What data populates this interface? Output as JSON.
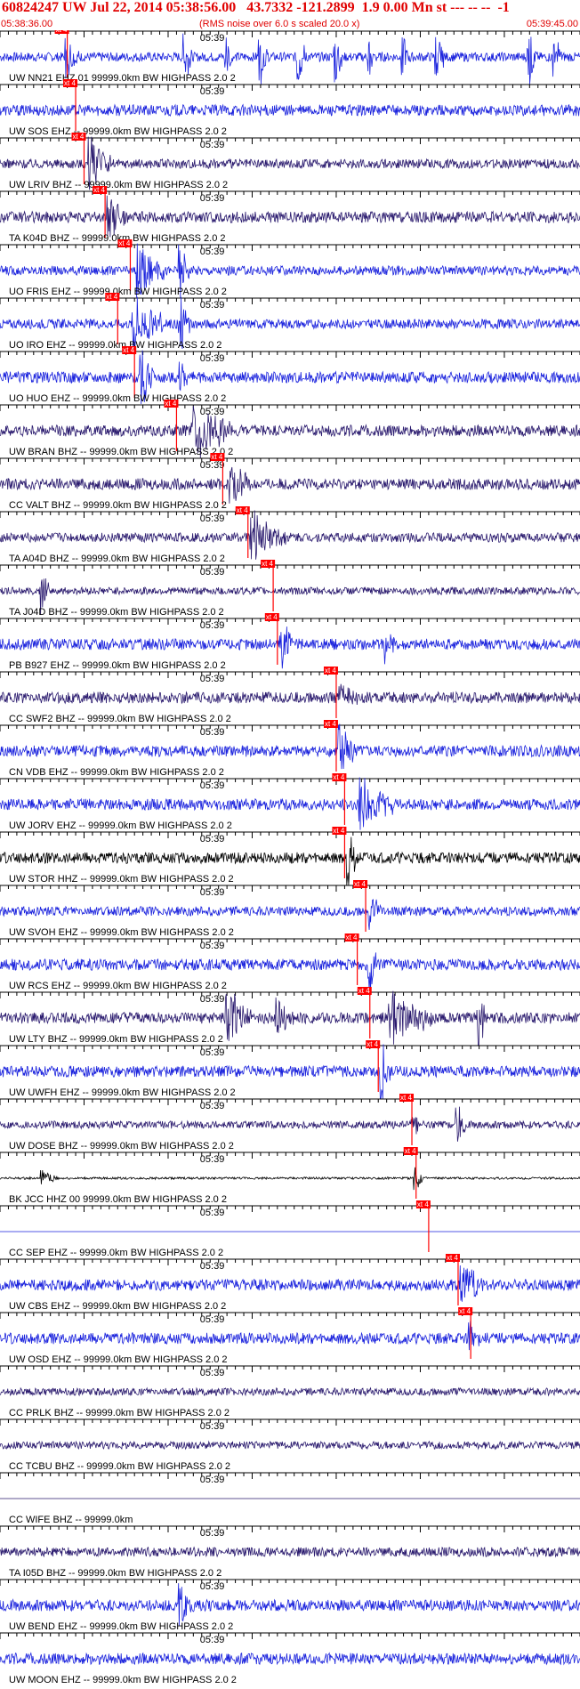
{
  "header": {
    "title": "60824247 UW Jul 22, 2014 05:38:56.00   43.7332 -121.2899  1.9 0.00 Mn st --- -- --  -1",
    "start_time": "05:38:36.00",
    "end_time": "05:39:45.00",
    "rms_note": "(RMS noise over 6.0 s scaled 20.0 x)"
  },
  "chart_data": {
    "type": "line",
    "time_tick_label": "05:39",
    "pick_label": "xt 4",
    "colors": {
      "trace_dark": "#2a1a6e",
      "trace_blue": "#1a22dd",
      "trace_black": "#000000",
      "pick": "#ff0000",
      "text_red": "#e00000"
    },
    "traces": [
      {
        "label": "UW NN21 EHZ 01 99999.0km BW  HIGHPASS  2.0  2",
        "color": "blue",
        "pick": 8.0,
        "noise": 0.25,
        "events": [
          [
            8.0,
            0.6,
            1.5
          ],
          [
            22.0,
            0.9,
            0.8
          ],
          [
            27.0,
            0.8,
            0.9
          ],
          [
            31.0,
            0.8,
            0.9
          ],
          [
            35.5,
            0.9,
            1.0
          ],
          [
            40.0,
            0.9,
            0.9
          ],
          [
            44.0,
            0.8,
            0.8
          ],
          [
            48.0,
            0.7,
            0.9
          ],
          [
            52.0,
            0.8,
            0.9
          ],
          [
            63.0,
            0.9,
            0.8
          ],
          [
            66.0,
            0.8,
            0.9
          ]
        ]
      },
      {
        "label": "UW SOS EHZ -- 99999.0km BW  HIGHPASS  2.0  2",
        "color": "blue",
        "pick": 9.0,
        "noise": 0.3,
        "events": []
      },
      {
        "label": "UW LRIV BHZ -- 99999.0km BW  HIGHPASS  2.0  2",
        "color": "dark",
        "pick": 10.0,
        "noise": 0.25,
        "events": [
          [
            10.8,
            1.0,
            2.5
          ]
        ]
      },
      {
        "label": "TA K04D BHZ -- 99999.0km BW  HIGHPASS  2.0  2",
        "color": "dark",
        "pick": 12.5,
        "noise": 0.3,
        "events": [
          [
            13.0,
            0.7,
            2.0
          ]
        ]
      },
      {
        "label": "UO FRIS EHZ -- 99999.0km BW  HIGHPASS  2.0  2",
        "color": "blue",
        "pick": 15.5,
        "noise": 0.25,
        "events": [
          [
            16.5,
            1.0,
            3.0
          ],
          [
            21.5,
            1.0,
            1.0
          ]
        ]
      },
      {
        "label": "UO IRO EHZ -- 99999.0km BW  HIGHPASS  2.0  2",
        "color": "blue",
        "pick": 14.0,
        "noise": 0.25,
        "events": [
          [
            16.0,
            1.0,
            3.5
          ],
          [
            21.5,
            1.0,
            1.2
          ]
        ]
      },
      {
        "label": "UO HUO EHZ -- 99999.0km BW  HIGHPASS  2.0  2",
        "color": "blue",
        "pick": 16.0,
        "noise": 0.3,
        "events": [
          [
            16.8,
            1.0,
            2.0
          ],
          [
            21.5,
            0.5,
            0.8
          ]
        ]
      },
      {
        "label": "UW BRAN BHZ -- 99999.0km BW  HIGHPASS  2.0  2",
        "color": "dark",
        "pick": 21.0,
        "noise": 0.3,
        "events": [
          [
            23.0,
            1.0,
            5.0
          ]
        ]
      },
      {
        "label": "CC VALT BHZ -- 99999.0km BW  HIGHPASS  2.0  2",
        "color": "dark",
        "pick": 26.5,
        "noise": 0.3,
        "events": [
          [
            27.5,
            0.6,
            3.0
          ]
        ]
      },
      {
        "label": "TA A04D BHZ -- 99999.0km BW  HIGHPASS  2.0  2",
        "color": "dark",
        "pick": 29.5,
        "noise": 0.25,
        "events": [
          [
            30.0,
            0.9,
            4.0
          ]
        ]
      },
      {
        "label": "TA J04D BHZ -- 99999.0km BW  HIGHPASS  2.0  2",
        "color": "dark",
        "pick": 32.5,
        "noise": 0.2,
        "events": [
          [
            5.0,
            0.7,
            1.0
          ]
        ]
      },
      {
        "label": "PB B927 EHZ -- 99999.0km BW  HIGHPASS  2.0  2",
        "color": "blue",
        "pick": 33.0,
        "noise": 0.3,
        "events": [
          [
            33.5,
            0.8,
            1.5
          ],
          [
            46.0,
            0.6,
            1.2
          ]
        ]
      },
      {
        "label": "CC SWF2 BHZ -- 99999.0km BW  HIGHPASS  2.0  2",
        "color": "dark",
        "pick": 40.0,
        "noise": 0.3,
        "events": [
          [
            40.5,
            0.4,
            2.0
          ]
        ]
      },
      {
        "label": "CN VDB EHZ -- 99999.0km BW  HIGHPASS  2.0  2",
        "color": "blue",
        "pick": 40.0,
        "noise": 0.3,
        "events": [
          [
            40.5,
            1.0,
            2.0
          ]
        ]
      },
      {
        "label": "UW JORV EHZ -- 99999.0km BW  HIGHPASS  2.0  2",
        "color": "blue",
        "pick": 41.0,
        "noise": 0.3,
        "events": [
          [
            43.0,
            0.9,
            4.0
          ]
        ]
      },
      {
        "label": "UW STOR HHZ -- 99999.0km BW  HIGHPASS  2.0  2",
        "color": "black",
        "pick": 41.0,
        "noise": 0.3,
        "events": [
          [
            41.5,
            1.0,
            1.0
          ]
        ]
      },
      {
        "label": "UW SVOH EHZ -- 99999.0km BW  HIGHPASS  2.0  2",
        "color": "blue",
        "pick": 43.5,
        "noise": 0.25,
        "events": [
          [
            44.0,
            0.6,
            1.5
          ]
        ]
      },
      {
        "label": "UW RCS EHZ -- 99999.0km BW  HIGHPASS  2.0  2",
        "color": "blue",
        "pick": 42.5,
        "noise": 0.3,
        "events": [
          [
            44.0,
            0.7,
            1.5
          ]
        ]
      },
      {
        "label": "UW LTY BHZ -- 99999.0km BW  HIGHPASS  2.0  2",
        "color": "dark",
        "pick": 44.0,
        "noise": 0.3,
        "events": [
          [
            27.0,
            1.0,
            3.0
          ],
          [
            33.0,
            0.8,
            2.0
          ],
          [
            46.5,
            1.0,
            5.0
          ],
          [
            57.0,
            1.0,
            1.0
          ]
        ]
      },
      {
        "label": "UW UWFH EHZ -- 99999.0km BW  HIGHPASS  2.0  2",
        "color": "blue",
        "pick": 45.0,
        "noise": 0.3,
        "events": [
          [
            45.5,
            1.0,
            1.0
          ]
        ]
      },
      {
        "label": "UW DOSE BHZ -- 99999.0km BW  HIGHPASS  2.0  2",
        "color": "dark",
        "pick": 49.0,
        "noise": 0.2,
        "events": [
          [
            49.0,
            0.5,
            1.2
          ],
          [
            54.5,
            0.7,
            1.0
          ]
        ]
      },
      {
        "label": "BK JCC HHZ 00 99999.0km BW  HIGHPASS  2.0  2",
        "color": "black",
        "pick": 49.5,
        "noise": 0.06,
        "events": [
          [
            5.0,
            0.3,
            2.0
          ],
          [
            49.5,
            0.4,
            1.0
          ]
        ]
      },
      {
        "label": "CC SEP EHZ -- 99999.0km BW  HIGHPASS  2.0  2",
        "color": "blue",
        "pick": 51.0,
        "noise": 0.0,
        "events": []
      },
      {
        "label": "UW CBS EHZ -- 99999.0km BW  HIGHPASS  2.0  2",
        "color": "blue",
        "pick": 54.5,
        "noise": 0.3,
        "events": [
          [
            55.0,
            0.9,
            2.5
          ]
        ]
      },
      {
        "label": "UW OSD EHZ -- 99999.0km BW  HIGHPASS  2.0  2",
        "color": "blue",
        "pick": 56.0,
        "noise": 0.3,
        "events": [
          [
            56.0,
            0.7,
            1.0
          ]
        ]
      },
      {
        "label": "CC PRLK BHZ -- 99999.0km BW  HIGHPASS  2.0  2",
        "color": "dark",
        "pick": null,
        "noise": 0.2,
        "events": []
      },
      {
        "label": "CC TCBU BHZ -- 99999.0km BW  HIGHPASS  2.0  2",
        "color": "dark",
        "pick": null,
        "noise": 0.2,
        "events": []
      },
      {
        "label": "CC WIFE BHZ -- 99999.0km",
        "color": "dark",
        "pick": null,
        "noise": 0.0,
        "events": []
      },
      {
        "label": "TA I05D BHZ -- 99999.0km BW  HIGHPASS  2.0  2",
        "color": "dark",
        "pick": null,
        "noise": 0.25,
        "events": []
      },
      {
        "label": "UW BEND EHZ -- 99999.0km BW  HIGHPASS  2.0  2",
        "color": "blue",
        "pick": null,
        "noise": 0.3,
        "events": [
          [
            21.5,
            0.6,
            1.5
          ]
        ]
      },
      {
        "label": "UW MOON EHZ -- 99999.0km BW  HIGHPASS  2.0  2",
        "color": "blue",
        "pick": null,
        "noise": 0.3,
        "events": []
      }
    ]
  }
}
